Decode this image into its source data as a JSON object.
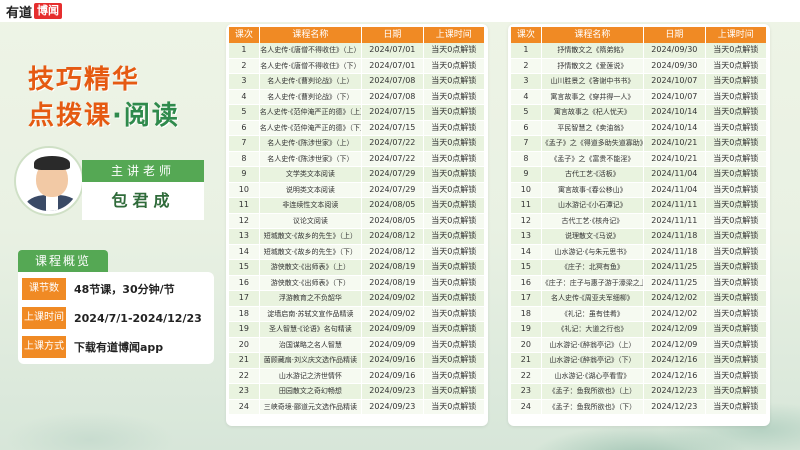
{
  "logo": {
    "text": "有道",
    "box": "博闻"
  },
  "hero": {
    "line1": "技巧精华",
    "line2": "点拨课",
    "dot": "·",
    "accent": "阅读"
  },
  "teacher": {
    "label": "主讲老师",
    "name": "包君成"
  },
  "overview": {
    "label": "课程概览",
    "rows": [
      {
        "tag": "课节数",
        "value": "48节课，30分钟/节"
      },
      {
        "tag": "上课时间",
        "value": "2024/7/1-2024/12/23"
      },
      {
        "tag": "上课方式",
        "value": "下载有道博闻app"
      }
    ]
  },
  "table_headers": [
    "课次",
    "课程名称",
    "日期",
    "上课时间"
  ],
  "left_table": [
    {
      "no": "1",
      "name": "名人史传·《唐僧不得收住》（上）",
      "date": "2024/07/01",
      "unlock": "当天0点解锁"
    },
    {
      "no": "2",
      "name": "名人史传·《唐僧不得收住》（下）",
      "date": "2024/07/01",
      "unlock": "当天0点解锁"
    },
    {
      "no": "3",
      "name": "名人史传·《曹刿论战》（上）",
      "date": "2024/07/08",
      "unlock": "当天0点解锁"
    },
    {
      "no": "4",
      "name": "名人史传·《曹刿论战》（下）",
      "date": "2024/07/08",
      "unlock": "当天0点解锁"
    },
    {
      "no": "5",
      "name": "名人史传·《范仲淹严正的德》（上）",
      "date": "2024/07/15",
      "unlock": "当天0点解锁"
    },
    {
      "no": "6",
      "name": "名人史传·《范仲淹严正的德》（下）",
      "date": "2024/07/15",
      "unlock": "当天0点解锁"
    },
    {
      "no": "7",
      "name": "名人史传·《陈涉世家》（上）",
      "date": "2024/07/22",
      "unlock": "当天0点解锁"
    },
    {
      "no": "8",
      "name": "名人史传·《陈涉世家》（下）",
      "date": "2024/07/22",
      "unlock": "当天0点解锁"
    },
    {
      "no": "9",
      "name": "文学类文本阅读",
      "date": "2024/07/29",
      "unlock": "当天0点解锁"
    },
    {
      "no": "10",
      "name": "说明类文本阅读",
      "date": "2024/07/29",
      "unlock": "当天0点解锁"
    },
    {
      "no": "11",
      "name": "非连续性文本阅读",
      "date": "2024/08/05",
      "unlock": "当天0点解锁"
    },
    {
      "no": "12",
      "name": "议论文阅读",
      "date": "2024/08/05",
      "unlock": "当天0点解锁"
    },
    {
      "no": "13",
      "name": "短城散文·《故乡的先生》（上）",
      "date": "2024/08/12",
      "unlock": "当天0点解锁"
    },
    {
      "no": "14",
      "name": "短城散文·《故乡的先生》（下）",
      "date": "2024/08/12",
      "unlock": "当天0点解锁"
    },
    {
      "no": "15",
      "name": "游侠散文·《出师表》（上）",
      "date": "2024/08/19",
      "unlock": "当天0点解锁"
    },
    {
      "no": "16",
      "name": "游侠散文·《出师表》（下）",
      "date": "2024/08/19",
      "unlock": "当天0点解锁"
    },
    {
      "no": "17",
      "name": "浮游教育之不负韶华",
      "date": "2024/09/02",
      "unlock": "当天0点解锁"
    },
    {
      "no": "18",
      "name": "淀墙启南·苏轼文宣作品精读",
      "date": "2024/09/02",
      "unlock": "当天0点解锁"
    },
    {
      "no": "19",
      "name": "圣人智慧·《论语》名句精读",
      "date": "2024/09/09",
      "unlock": "当天0点解锁"
    },
    {
      "no": "20",
      "name": "治国谋略之名人智慧",
      "date": "2024/09/09",
      "unlock": "当天0点解锁"
    },
    {
      "no": "21",
      "name": "菌顾藏扇·刘义庆文选作品精读",
      "date": "2024/09/16",
      "unlock": "当天0点解锁"
    },
    {
      "no": "22",
      "name": "山水游记之济世情怀",
      "date": "2024/09/16",
      "unlock": "当天0点解锁"
    },
    {
      "no": "23",
      "name": "田园散文之奇幻畅想",
      "date": "2024/09/23",
      "unlock": "当天0点解锁"
    },
    {
      "no": "24",
      "name": "三峡奇境·郦道元文选作品精读",
      "date": "2024/09/23",
      "unlock": "当天0点解锁"
    }
  ],
  "right_table": [
    {
      "no": "1",
      "name": "抒情散文之《隋弟銘》",
      "date": "2024/09/30",
      "unlock": "当天0点解锁"
    },
    {
      "no": "2",
      "name": "抒情散文之《爱莲说》",
      "date": "2024/09/30",
      "unlock": "当天0点解锁"
    },
    {
      "no": "3",
      "name": "山川胜景之《答谢中书书》",
      "date": "2024/10/07",
      "unlock": "当天0点解锁"
    },
    {
      "no": "4",
      "name": "寓言故事之《穿井得一人》",
      "date": "2024/10/07",
      "unlock": "当天0点解锁"
    },
    {
      "no": "5",
      "name": "寓言故事之《杞人忧天》",
      "date": "2024/10/14",
      "unlock": "当天0点解锁"
    },
    {
      "no": "6",
      "name": "平民智慧之《卖油翁》",
      "date": "2024/10/14",
      "unlock": "当天0点解锁"
    },
    {
      "no": "7",
      "name": "《孟子》之《得道多助失道寡助》",
      "date": "2024/10/21",
      "unlock": "当天0点解锁"
    },
    {
      "no": "8",
      "name": "《孟子》之《富贵不能淫》",
      "date": "2024/10/21",
      "unlock": "当天0点解锁"
    },
    {
      "no": "9",
      "name": "古代工艺·《活板》",
      "date": "2024/11/04",
      "unlock": "当天0点解锁"
    },
    {
      "no": "10",
      "name": "寓言故事·《春公移山》",
      "date": "2024/11/04",
      "unlock": "当天0点解锁"
    },
    {
      "no": "11",
      "name": "山水游记·《小石潭记》",
      "date": "2024/11/11",
      "unlock": "当天0点解锁"
    },
    {
      "no": "12",
      "name": "古代工艺·《核舟记》",
      "date": "2024/11/11",
      "unlock": "当天0点解锁"
    },
    {
      "no": "13",
      "name": "说理散文·《马说》",
      "date": "2024/11/18",
      "unlock": "当天0点解锁"
    },
    {
      "no": "14",
      "name": "山水游记·《与朱元思书》",
      "date": "2024/11/18",
      "unlock": "当天0点解锁"
    },
    {
      "no": "15",
      "name": "《庄子：北冥有鱼》",
      "date": "2024/11/25",
      "unlock": "当天0点解锁"
    },
    {
      "no": "16",
      "name": "《庄子：庄子与惠子游于濠梁之上》",
      "date": "2024/11/25",
      "unlock": "当天0点解锁"
    },
    {
      "no": "17",
      "name": "名人史传·《周亚夫军细柳》",
      "date": "2024/12/02",
      "unlock": "当天0点解锁"
    },
    {
      "no": "18",
      "name": "《礼记：虽有佳肴》",
      "date": "2024/12/02",
      "unlock": "当天0点解锁"
    },
    {
      "no": "19",
      "name": "《礼记：大道之行也》",
      "date": "2024/12/09",
      "unlock": "当天0点解锁"
    },
    {
      "no": "20",
      "name": "山水游记·《醉翁亭记》（上）",
      "date": "2024/12/09",
      "unlock": "当天0点解锁"
    },
    {
      "no": "21",
      "name": "山水游记·《醉翁亭记》（下）",
      "date": "2024/12/16",
      "unlock": "当天0点解锁"
    },
    {
      "no": "22",
      "name": "山水游记·《湖心亭看雪》",
      "date": "2024/12/16",
      "unlock": "当天0点解锁"
    },
    {
      "no": "23",
      "name": "《孟子：鱼我所欲也》（上）",
      "date": "2024/12/23",
      "unlock": "当天0点解锁"
    },
    {
      "no": "24",
      "name": "《孟子：鱼我所欲也》（下）",
      "date": "2024/12/23",
      "unlock": "当天0点解锁"
    }
  ],
  "colors": {
    "orange": "#f08a24",
    "green": "#55a854",
    "title_orange": "#e55a12",
    "title_green": "#2f8a4c"
  }
}
